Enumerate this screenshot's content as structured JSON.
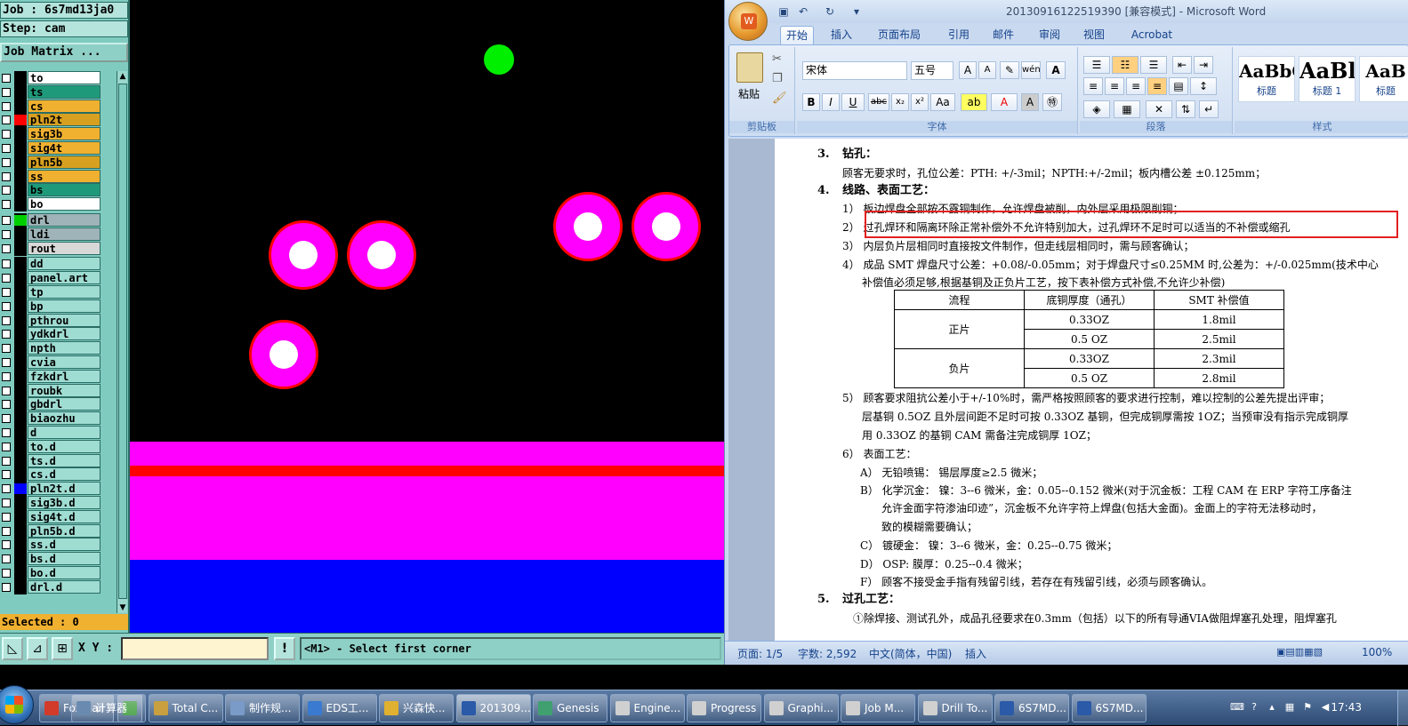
{
  "genesis": {
    "job_label": "Job : 6s7md13ja0",
    "step_label": "Step: cam",
    "job_matrix_button": "Job Matrix ...",
    "selected_label": "Selected : 0",
    "xy_label": "X Y :",
    "xy_value": "",
    "warn_icon_label": "!",
    "status_message": "<M1> - Select first corner",
    "layers": [
      {
        "name": "to",
        "bg": "#ffffff",
        "color": "#000000",
        "mark": "✍"
      },
      {
        "name": "ts",
        "bg": "#1e9a7a",
        "color": "#000000",
        "mark": ""
      },
      {
        "name": "cs",
        "bg": "#f0b030",
        "color": "#000000",
        "mark": ""
      },
      {
        "name": "pln2t",
        "bg": "#d8a020",
        "color": "#ff0000",
        "mark": "⊞"
      },
      {
        "name": "sig3b",
        "bg": "#f0b030",
        "color": "#000000",
        "mark": ""
      },
      {
        "name": "sig4t",
        "bg": "#f0b030",
        "color": "#000000",
        "mark": ""
      },
      {
        "name": "pln5b",
        "bg": "#d8a020",
        "color": "#000000",
        "mark": ""
      },
      {
        "name": "ss",
        "bg": "#f0b030",
        "color": "#000000",
        "mark": ""
      },
      {
        "name": "bs",
        "bg": "#1e9a7a",
        "color": "#000000",
        "mark": ""
      },
      {
        "name": "bo",
        "bg": "#ffffff",
        "color": "#000000",
        "mark": "✍"
      },
      {
        "name": "drl",
        "bg": "#9fb4b8",
        "color": "#00d000",
        "mark": ""
      },
      {
        "name": "ldi",
        "bg": "#9fb4b8",
        "color": "#000000",
        "mark": ""
      },
      {
        "name": "rout",
        "bg": "#d8d8d8",
        "color": "#000000",
        "mark": ""
      },
      {
        "name": "dd",
        "bg": "#9fdcd2",
        "color": "#000000",
        "mark": ""
      },
      {
        "name": "panel.art",
        "bg": "#9fdcd2",
        "color": "#000000",
        "mark": ""
      },
      {
        "name": "tp",
        "bg": "#9fdcd2",
        "color": "#000000",
        "mark": ""
      },
      {
        "name": "bp",
        "bg": "#9fdcd2",
        "color": "#000000",
        "mark": ""
      },
      {
        "name": "pthrou",
        "bg": "#9fdcd2",
        "color": "#000000",
        "mark": ""
      },
      {
        "name": "ydkdrl",
        "bg": "#9fdcd2",
        "color": "#000000",
        "mark": ""
      },
      {
        "name": "npth",
        "bg": "#9fdcd2",
        "color": "#000000",
        "mark": ""
      },
      {
        "name": "cvia",
        "bg": "#9fdcd2",
        "color": "#000000",
        "mark": ""
      },
      {
        "name": "fzkdrl",
        "bg": "#9fdcd2",
        "color": "#000000",
        "mark": ""
      },
      {
        "name": "roubk",
        "bg": "#9fdcd2",
        "color": "#000000",
        "mark": ""
      },
      {
        "name": "gbdrl",
        "bg": "#9fdcd2",
        "color": "#000000",
        "mark": ""
      },
      {
        "name": "biaozhu",
        "bg": "#9fdcd2",
        "color": "#000000",
        "mark": ""
      },
      {
        "name": "d",
        "bg": "#9fdcd2",
        "color": "#000000",
        "mark": ""
      },
      {
        "name": "to.d",
        "bg": "#9fdcd2",
        "color": "#000000",
        "mark": "✍"
      },
      {
        "name": "ts.d",
        "bg": "#9fdcd2",
        "color": "#000000",
        "mark": ""
      },
      {
        "name": "cs.d",
        "bg": "#9fdcd2",
        "color": "#000000",
        "mark": ""
      },
      {
        "name": "pln2t.d",
        "bg": "#9fdcd2",
        "color": "#0000ff",
        "mark": ""
      },
      {
        "name": "sig3b.d",
        "bg": "#9fdcd2",
        "color": "#000000",
        "mark": ""
      },
      {
        "name": "sig4t.d",
        "bg": "#9fdcd2",
        "color": "#000000",
        "mark": ""
      },
      {
        "name": "pln5b.d",
        "bg": "#9fdcd2",
        "color": "#000000",
        "mark": ""
      },
      {
        "name": "ss.d",
        "bg": "#9fdcd2",
        "color": "#000000",
        "mark": ""
      },
      {
        "name": "bs.d",
        "bg": "#9fdcd2",
        "color": "#000000",
        "mark": ""
      },
      {
        "name": "bo.d",
        "bg": "#9fdcd2",
        "color": "#000000",
        "mark": "✍"
      },
      {
        "name": "drl.d",
        "bg": "#9fdcd2",
        "color": "#000000",
        "mark": ""
      }
    ]
  },
  "word": {
    "title": "20130916122519390 [兼容模式] - Microsoft Word",
    "tabs": [
      "开始",
      "插入",
      "页面布局",
      "引用",
      "邮件",
      "审阅",
      "视图",
      "Acrobat"
    ],
    "clipboard": {
      "paste_label": "粘贴",
      "group_label": "剪贴板"
    },
    "font": {
      "name": "宋体",
      "size": "五号",
      "group_label": "字体"
    },
    "paragraph": {
      "group_label": "段落"
    },
    "styles": {
      "group_label": "样式",
      "items": [
        {
          "sample": "AaBbC",
          "name": "标题"
        },
        {
          "sample": "AaBl",
          "name": "标题 1"
        },
        {
          "sample": "AaB",
          "name": "标题"
        }
      ]
    },
    "doc": {
      "h3_num": "3.",
      "h3": "钻孔：",
      "l1": "顾客无要求时，孔位公差：PTH: +/-3mil；NPTH:+/-2mil；板内槽公差 ±0.125mm；",
      "h4_num": "4.",
      "h4": "线路、表面工艺：",
      "l2": "1） 板边焊盘全部按不露铜制作，允许焊盘被削，内外层采用极限削铜；",
      "l3": "2） 过孔焊环和隔离环除正常补偿外不允许特别加大，过孔焊环不足时可以适当的不补偿或缩孔",
      "l4": "3） 内层负片层相同时直接按文件制作，但走线层相同时，需与顾客确认；",
      "l5": "4） 成品 SMT 焊盘尺寸公差：+0.08/-0.05mm；对于焊盘尺寸≤0.25MM 时,公差为：+/-0.025mm(技术中心",
      "l6": "补偿值必须足够,根据基铜及正负片工艺，按下表补偿方式补偿,不允许少补偿)",
      "table_headers": [
        "流程",
        "底铜厚度（通孔）",
        "SMT 补偿值"
      ],
      "table_rows": [
        [
          "正片",
          "0.33OZ",
          "1.8mil"
        ],
        [
          "",
          "0.5 OZ",
          "2.5mil"
        ],
        [
          "负片",
          "0.33OZ",
          "2.3mil"
        ],
        [
          "",
          "0.5 OZ",
          "2.8mil"
        ]
      ],
      "l7": "5） 顾客要求阻抗公差小于+/-10%时，需严格按照顾客的要求进行控制，难以控制的公差先提出评审；",
      "l8": "层基铜 0.5OZ 且外层间距不足时可按 0.33OZ 基铜，但完成铜厚需按 1OZ；当预审没有指示完成铜厚",
      "l9": "用 0.33OZ 的基铜 CAM 需备注完成铜厚 1OZ；",
      "l10": "6） 表面工艺：",
      "l11": "A） 无铅喷锡： 锡层厚度≥2.5 微米；",
      "l12": "B） 化学沉金：  镍：3--6 微米，金：0.05--0.152 微米(对于沉金板：工程 CAM 在 ERP 字符工序备注",
      "l13": "允许金面字符渗油印迹”，沉金板不允许字符上焊盘(包括大金面)。金面上的字符无法移动时，",
      "l14": "致的模糊需要确认；",
      "l15": "C） 镀硬金：    镍：3--6 微米，金：0.25--0.75 微米；",
      "l16": "D） OSP:       膜厚：0.25--0.4 微米；",
      "l17": "F） 顾客不接受金手指有残留引线，若存在有残留引线，必须与顾客确认。",
      "h5_num": "5.",
      "h5": "过孔工艺：",
      "l18": "①除焊接、测试孔外，成品孔径要求在0.3mm（包括）以下的所有导通VIA做阻焊塞孔处理，阻焊塞孔"
    },
    "status": {
      "page": "页面: 1/5",
      "words": "字数: 2,592",
      "lang": "中文(简体，中国)",
      "mode": "插入",
      "zoom": "100%"
    }
  },
  "taskbar": {
    "items": [
      {
        "label": "Foxmail",
        "color": "#d23a2a"
      },
      {
        "label": "",
        "color": "#3a9a3a"
      },
      {
        "label": "计算器",
        "color": "#6a8ab0"
      },
      {
        "label": "Total C...",
        "color": "#c8a040"
      },
      {
        "label": "制作规...",
        "color": "#7a9ac8"
      },
      {
        "label": "EDS工...",
        "color": "#3a7ad0"
      },
      {
        "label": "兴森快...",
        "color": "#e0b030"
      },
      {
        "label": "201309...",
        "color": "#2a5aa8"
      },
      {
        "label": "Genesis",
        "color": "#40a070"
      },
      {
        "label": "Engine...",
        "color": "#d0d0d0"
      },
      {
        "label": "Progress",
        "color": "#d0d0d0"
      },
      {
        "label": "Graphi...",
        "color": "#d0d0d0"
      },
      {
        "label": "Job M...",
        "color": "#d0d0d0"
      },
      {
        "label": "Drill To...",
        "color": "#d0d0d0"
      },
      {
        "label": "6S7MD...",
        "color": "#2a5aa8"
      },
      {
        "label": "6S7MD...",
        "color": "#2a5aa8"
      }
    ],
    "time": "17:43"
  }
}
